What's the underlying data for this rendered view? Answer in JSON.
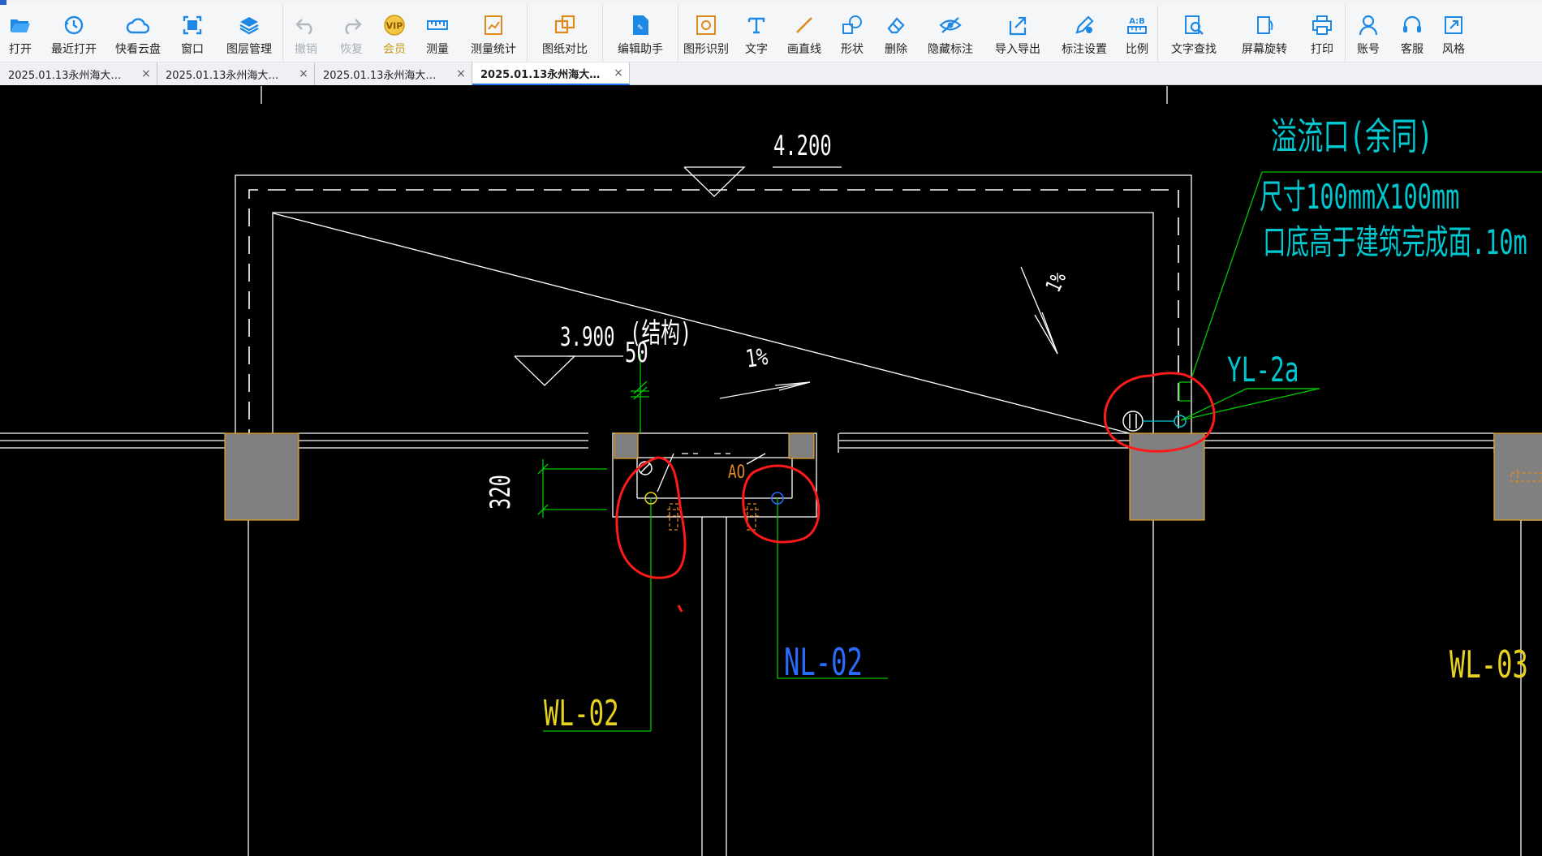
{
  "toolbar": {
    "open": "打开",
    "recent": "最近打开",
    "cloud": "快看云盘",
    "window": "窗口",
    "layers": "图层管理",
    "undo": "撤销",
    "redo": "恢复",
    "vip": "会员",
    "measure": "测量",
    "measure_stats": "测量统计",
    "compare": "图纸对比",
    "edit_assistant": "编辑助手",
    "shape_recognize": "图形识别",
    "text": "文字",
    "draw_line": "画直线",
    "shape": "形状",
    "delete": "删除",
    "hide_annotation": "隐藏标注",
    "import_export": "导入导出",
    "annotation_settings": "标注设置",
    "scale": "比例",
    "text_search": "文字查找",
    "rotate_screen": "屏幕旋转",
    "print": "打印",
    "account": "账号",
    "support": "客服",
    "style": "风格",
    "vip_badge": "VIP",
    "scale_badge": "A:B"
  },
  "tabs": [
    {
      "label": "2025.01.13永州海大…",
      "close": "×"
    },
    {
      "label": "2025.01.13永州海大…",
      "close": "×"
    },
    {
      "label": "2025.01.13永州海大…",
      "close": "×"
    },
    {
      "label": "2025.01.13永州海大…",
      "close": "×"
    }
  ],
  "drawing": {
    "elev_top": "4.200",
    "elev_struct": "3.900",
    "struct_note": "(结构)",
    "dim_50": "50",
    "dim_320": "320",
    "slope_1": "1%",
    "slope_2": "1%",
    "overflow_title": "溢流口(余同)",
    "overflow_size": "尺寸100mmX100mm",
    "overflow_height": "口底高于建筑完成面.10m",
    "yl2a": "YL-2a",
    "wl02": "WL-02",
    "nl02": "NL-02",
    "wl03": "WL-03",
    "ao": "AO"
  },
  "colors": {
    "cad_bg": "#000000",
    "cad_white": "#ffffff",
    "cad_green": "#00c800",
    "cad_cyan": "#00c8d0",
    "cad_yellow": "#e6d21e",
    "cad_blue": "#2a6cff",
    "cad_orange": "#e08a1e",
    "markup_red": "#ff1a1a",
    "column_gray": "#808080",
    "tab_active": "#1a73e8"
  }
}
